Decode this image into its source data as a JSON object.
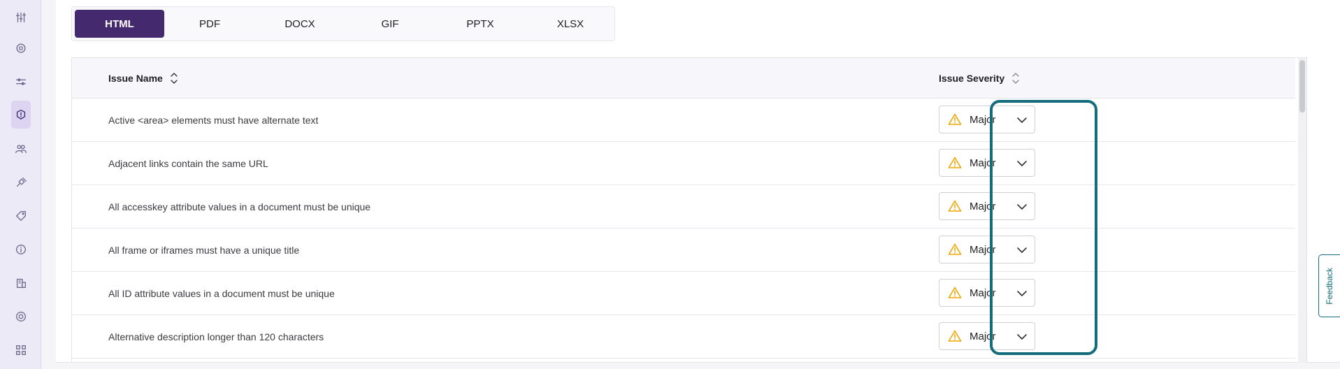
{
  "tabs": [
    {
      "label": "HTML",
      "active": true
    },
    {
      "label": "PDF"
    },
    {
      "label": "DOCX"
    },
    {
      "label": "GIF"
    },
    {
      "label": "PPTX"
    },
    {
      "label": "XLSX"
    }
  ],
  "table": {
    "columns": {
      "name": "Issue Name",
      "severity": "Issue Severity"
    },
    "rows": [
      {
        "name": "Active <area> elements must have alternate text",
        "severity": "Major"
      },
      {
        "name": "Adjacent links contain the same URL",
        "severity": "Major"
      },
      {
        "name": "All accesskey attribute values in a document must be unique",
        "severity": "Major"
      },
      {
        "name": "All frame or iframes must have a unique title",
        "severity": "Major"
      },
      {
        "name": "All ID attribute values in a document must be unique",
        "severity": "Major"
      },
      {
        "name": "Alternative description longer than 120 characters",
        "severity": "Major"
      }
    ]
  },
  "feedback_label": "Feedback",
  "colors": {
    "accent": "#45296f",
    "highlight": "#146c7c",
    "warning": "#f0a500"
  },
  "rail_icons": [
    "sliders-icon",
    "settings-gear-icon",
    "tune-icon",
    "issues-icon",
    "users-icon",
    "integrations-plug-icon",
    "tag-icon",
    "info-icon",
    "building-icon",
    "target-icon",
    "apps-grid-icon"
  ]
}
